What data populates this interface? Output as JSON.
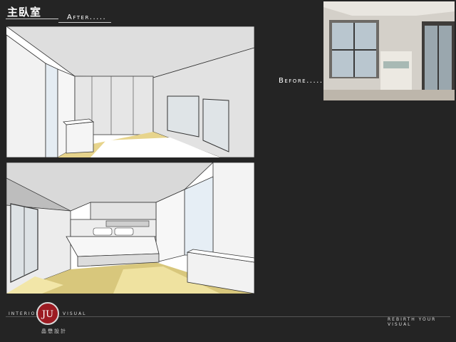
{
  "header": {
    "title": "主臥室",
    "after_label": "After.....",
    "before_label": "Before....."
  },
  "footer": {
    "brand_left": "INTERIOR",
    "brand_right": "VISUAL",
    "brand_chinese": "晶懋設計",
    "logo_text": "JU",
    "tagline": "REBIRTH YOUR VISUAL"
  },
  "colors": {
    "background": "#242424",
    "floor": "#e7d48c",
    "logo_red": "#9c1b22"
  }
}
